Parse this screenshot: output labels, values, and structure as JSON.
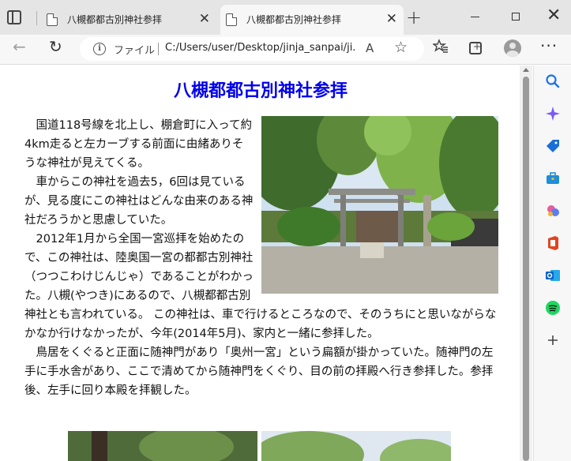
{
  "browser": {
    "tabs": [
      {
        "title": "八槻都都古別神社参拝",
        "close": "✕"
      },
      {
        "title": "八槻都都古別神社参拝",
        "close": "✕"
      }
    ],
    "new_tab": "+",
    "window_controls": {
      "close": "✕"
    },
    "address_bar": {
      "file_label": "ファイル",
      "url": "C:/Users/user/Desktop/jinja_sanpai/ji..."
    },
    "toolbar_glyphs": {
      "back": "←",
      "reload": "↻",
      "read_aloud": "A",
      "favorite": "☆",
      "favorites": "☆",
      "more": "···"
    },
    "sidebar_icons": [
      "search-icon",
      "copilot-icon",
      "shopping-tag-icon",
      "tools-icon",
      "games-icon",
      "office-icon",
      "outlook-icon",
      "spotify-icon",
      "add-icon"
    ],
    "colors": {
      "title": "#0000ee",
      "tabstrip": "#e5e5e5",
      "toolbar": "#f7f7f7"
    }
  },
  "page": {
    "title": "八槻都都古別神社参拝",
    "paragraphs": [
      "国道118号線を北上し、棚倉町に入って約4km走ると左カーブする前面に由緒ありそうな神社が見えてくる。",
      "車からこの神社を過去5，6回は見ているが、見る度にこの神社はどんな由来のある神社だろうかと思慮していた。",
      "2012年1月から全国一宮巡拝を始めたので、この神社は、陸奥国一宮の都都古別神社（つつこわけじんじゃ）であることがわかった。八槻(やつき)にあるので、八槻都都古別神社とも言われている。 この神社は、車で行けるところなので、そのうちにと思いながらなかなか行けなかったが、今年(2014年5月)、家内と一緒に参拝した。",
      "鳥居をくぐると正面に随神門があり「奥州一宮」という扁額が掛かっていた。随神門の左手に手水舎があり、ここで清めてから随神門をくぐり、目の前の拝殿へ行き参拝した。参拝後、左手に回り本殿を拝観した。"
    ]
  }
}
